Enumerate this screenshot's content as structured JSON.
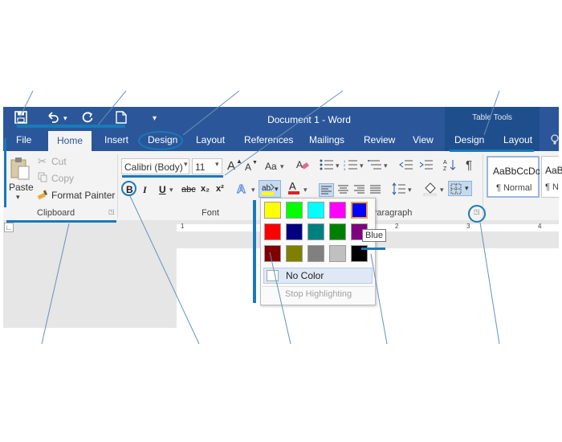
{
  "window": {
    "doc_title": "Document 1 - Word",
    "table_tools_label": "Table Tools"
  },
  "qat": {
    "save_icon": "save-icon",
    "undo_icon": "undo-icon",
    "redo_icon": "redo-icon",
    "new_icon": "new-document-icon",
    "customize_icon": "customize-qat-icon"
  },
  "tabs": [
    {
      "label": "File"
    },
    {
      "label": "Home"
    },
    {
      "label": "Insert"
    },
    {
      "label": "Design"
    },
    {
      "label": "Layout"
    },
    {
      "label": "References"
    },
    {
      "label": "Mailings"
    },
    {
      "label": "Review"
    },
    {
      "label": "View"
    },
    {
      "label": "Design"
    },
    {
      "label": "Layout"
    }
  ],
  "clipboard": {
    "paste": "Paste",
    "cut": "Cut",
    "copy": "Copy",
    "format_painter": "Format Painter",
    "group_label": "Clipboard"
  },
  "font": {
    "font_name": "Calibri (Body)",
    "font_size": "11",
    "grow": "A",
    "shrink": "A",
    "change_case": "Aa",
    "bold": "B",
    "italic": "I",
    "underline": "U",
    "strikethrough": "abc",
    "subscript": "x₂",
    "superscript": "x²",
    "group_label": "Font"
  },
  "paragraph": {
    "group_label": "Paragraph"
  },
  "styles": {
    "normal_preview": "AaBbCcDc",
    "normal_label": "¶ Normal",
    "nospacing_preview": "AaB",
    "nospacing_label": "¶ N"
  },
  "highlight_palette": {
    "colors": [
      [
        "#ffff00",
        "#00ff00",
        "#00ffff",
        "#ff00ff",
        "#0000ff"
      ],
      [
        "#ff0000",
        "#000080",
        "#008080",
        "#008000",
        "#800080"
      ],
      [
        "#800000",
        "#808000",
        "#808080",
        "#c0c0c0",
        "#000000"
      ]
    ],
    "no_color": "No Color",
    "stop_highlighting": "Stop Highlighting",
    "tooltip": "Blue"
  },
  "ruler": {
    "numbers": [
      "1",
      "2",
      "3",
      "4"
    ]
  }
}
